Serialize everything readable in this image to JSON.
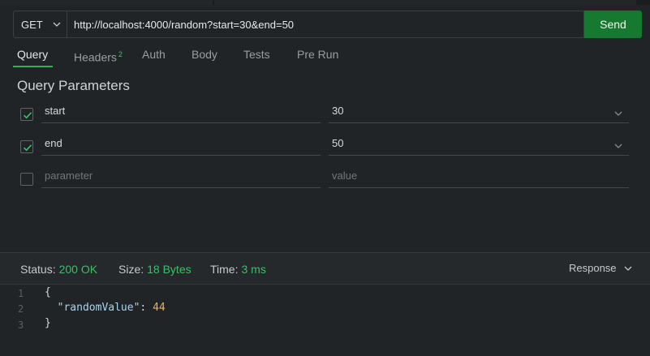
{
  "request": {
    "method": "GET",
    "url": "http://localhost:4000/random?start=30&end=50",
    "send_label": "Send"
  },
  "tabs": [
    {
      "label": "Query",
      "active": true
    },
    {
      "label": "Headers",
      "badge": "2"
    },
    {
      "label": "Auth"
    },
    {
      "label": "Body"
    },
    {
      "label": "Tests"
    },
    {
      "label": "Pre Run"
    }
  ],
  "query": {
    "title": "Query Parameters",
    "params": [
      {
        "name": "start",
        "value": "30",
        "checked": true
      },
      {
        "name": "end",
        "value": "50",
        "checked": true
      }
    ],
    "placeholder_name": "parameter",
    "placeholder_value": "value"
  },
  "response": {
    "status_label": "Status:",
    "status_value": "200 OK",
    "size_label": "Size:",
    "size_value": "18 Bytes",
    "time_label": "Time:",
    "time_value": "3 ms",
    "view_label": "Response",
    "lines": [
      {
        "n": "1",
        "open": "{"
      },
      {
        "n": "2",
        "key": "\"randomValue\"",
        "sep": ": ",
        "val": "44"
      },
      {
        "n": "3",
        "close": "}"
      }
    ]
  },
  "colors": {
    "accent": "#2bb24c",
    "send_button": "#17782f",
    "background": "#212426"
  }
}
